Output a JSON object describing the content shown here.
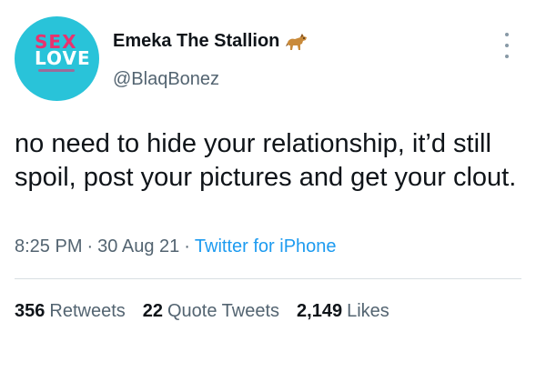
{
  "avatar": {
    "logo_line1": "SEX",
    "logo_line2": "LOVE",
    "background": "#29c3d9",
    "accent": "#e8326e"
  },
  "author": {
    "display_name": "Emeka The Stallion",
    "emoji_icon": "horse-icon",
    "handle": "@BlaqBonez"
  },
  "tweet": {
    "text": "no need to hide your relationship, it’d still spoil, post your pictures and get your clout."
  },
  "meta": {
    "time": "8:25 PM",
    "separator": "·",
    "date": "30 Aug 21",
    "source": "Twitter for iPhone",
    "source_color": "#1d9bf0"
  },
  "stats": {
    "retweets_count": "356",
    "retweets_label": "Retweets",
    "quotes_count": "22",
    "quotes_label": "Quote Tweets",
    "likes_count": "2,149",
    "likes_label": "Likes"
  }
}
